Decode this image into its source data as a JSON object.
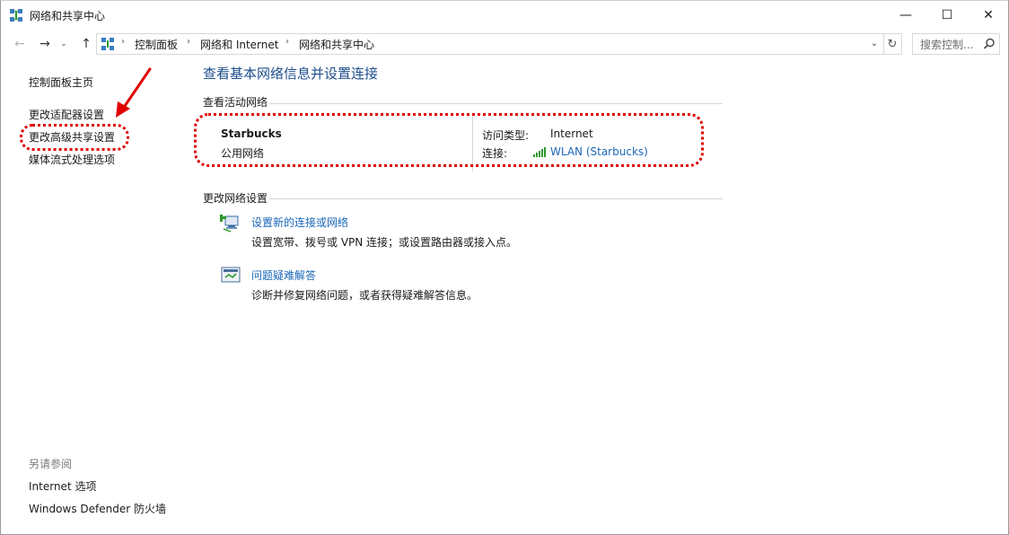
{
  "window": {
    "title": "网络和共享中心",
    "minimize_glyph": "—",
    "maximize_glyph": "☐",
    "close_glyph": "✕"
  },
  "nav": {
    "back_glyph": "←",
    "forward_glyph": "→",
    "recent_glyph": "⌄",
    "up_glyph": "↑",
    "breadcrumbs": [
      "控制面板",
      "网络和 Internet",
      "网络和共享中心"
    ],
    "refresh_glyph": "↻",
    "search_placeholder": "搜索控制...",
    "dropdown_glyph": "⌄"
  },
  "left_pane": {
    "home": "控制面板主页",
    "links": [
      "更改适配器设置",
      "更改高级共享设置",
      "媒体流式处理选项"
    ],
    "see_also_header": "另请参阅",
    "see_also": [
      "Internet 选项",
      "Windows Defender 防火墙"
    ]
  },
  "main": {
    "title": "查看基本网络信息并设置连接",
    "active_networks_header": "查看活动网络",
    "network": {
      "name": "Starbucks",
      "category": "公用网络",
      "access_type_label": "访问类型:",
      "access_type_value": "Internet",
      "connection_label": "连接:",
      "connection_value": "WLAN (Starbucks)"
    },
    "change_settings_header": "更改网络设置",
    "tasks": [
      {
        "title": "设置新的连接或网络",
        "desc": "设置宽带、拨号或 VPN 连接；或设置路由器或接入点。"
      },
      {
        "title": "问题疑难解答",
        "desc": "诊断并修复网络问题，或者获得疑难解答信息。"
      }
    ]
  },
  "colors": {
    "link": "#1a67b8",
    "title_blue": "#1e4e8c",
    "annotation_red": "#e00000"
  },
  "icons": {
    "app": "network-icon",
    "search": "search-icon",
    "signal": "wifi-signal-icon",
    "new_connection": "new-connection-icon",
    "troubleshoot": "troubleshoot-icon"
  }
}
